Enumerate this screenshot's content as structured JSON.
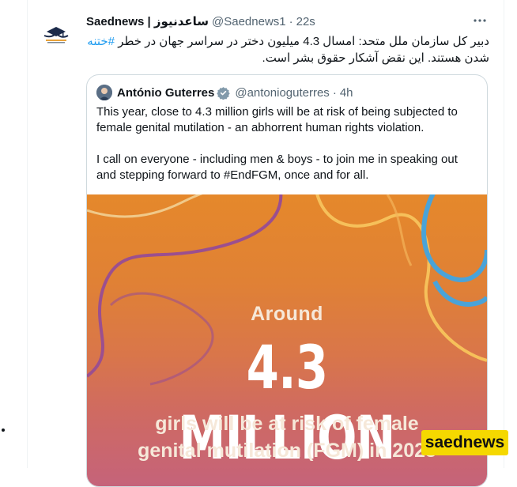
{
  "tweet": {
    "display_name": "Saednews | ساعدنیوز",
    "handle": "@Saednews1",
    "separator": "·",
    "time": "22s",
    "more_icon": "more-icon",
    "text_part1": "دبیر کل سازمان ملل متحد: امسال 4.3 میلیون دختر در سراسر جهان در خطر",
    "hashtag": "#ختنه",
    "text_part2": "شدن هستند. این نقض آشکار حقوق بشر است."
  },
  "quote": {
    "display_name": "António Guterres",
    "handle": "@antonioguterres",
    "separator": "·",
    "time": "4h",
    "paragraph1": "This year, close to 4.3 million girls will be at risk of being subjected to female genital mutilation - an abhorrent human rights violation.",
    "paragraph2": "I call on everyone - including men & boys - to join me in speaking out and stepping forward to #EndFGM, once and for all.",
    "media": {
      "line1": "Around",
      "line2": "4.3 MILLION",
      "line3": "girls will be at risk of female",
      "line4": "genital mutilation (FGM) in 2023"
    }
  },
  "watermark": "saednews",
  "colors": {
    "accent": "#1d9bf0",
    "verified": "#829aab",
    "watermark_bg": "#f5d800",
    "media_top": "#e5882b",
    "media_bottom": "#c5637a"
  }
}
